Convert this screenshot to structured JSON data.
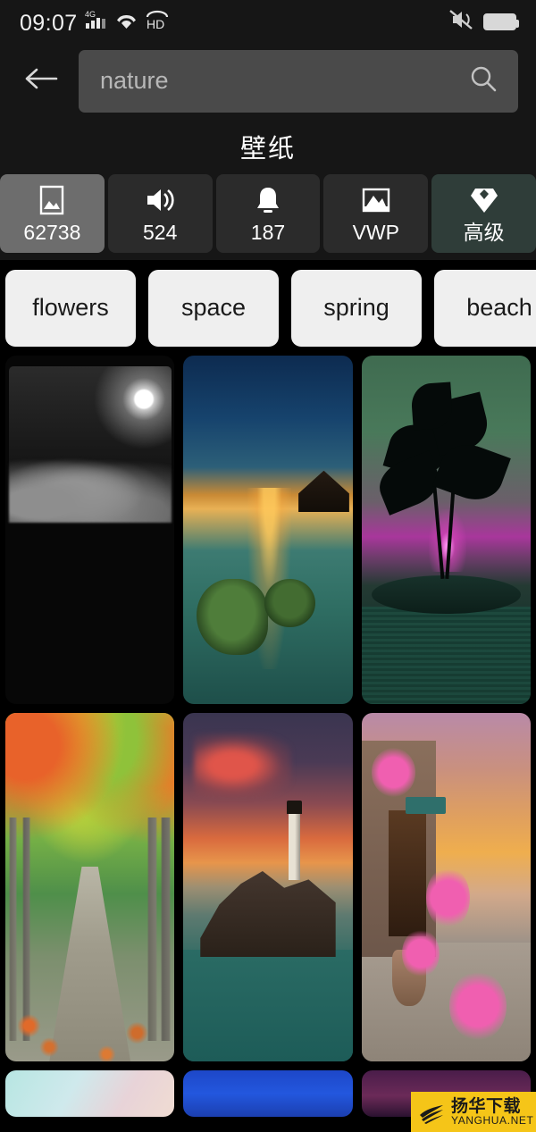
{
  "status_bar": {
    "time": "09:07",
    "network_label": "4G",
    "icons": [
      "signal-icon",
      "wifi-icon",
      "hd-icon",
      "vibrate-mute-icon",
      "battery-icon"
    ]
  },
  "search": {
    "back_icon": "back-arrow-icon",
    "value": "nature",
    "placeholder": "nature",
    "search_icon": "search-icon"
  },
  "header": {
    "title": "壁纸"
  },
  "tabs": [
    {
      "icon": "image-icon",
      "label": "62738",
      "selected": true,
      "style": "default"
    },
    {
      "icon": "speaker-icon",
      "label": "524",
      "selected": false,
      "style": "default"
    },
    {
      "icon": "bell-icon",
      "label": "187",
      "selected": false,
      "style": "default"
    },
    {
      "icon": "live-wallpaper-icon",
      "label": "VWP",
      "selected": false,
      "style": "default"
    },
    {
      "icon": "diamond-icon",
      "label": "高级",
      "selected": false,
      "style": "premium"
    }
  ],
  "chips": [
    {
      "label": "flowers"
    },
    {
      "label": "space"
    },
    {
      "label": "spring"
    },
    {
      "label": "beach"
    }
  ],
  "grid": {
    "rows": [
      [
        {
          "name": "moonlit-clouds-wallpaper"
        },
        {
          "name": "tropical-sunset-water-wallpaper"
        },
        {
          "name": "palm-trees-magenta-sky-wallpaper"
        }
      ],
      [
        {
          "name": "autumn-tree-path-wallpaper"
        },
        {
          "name": "lighthouse-sunset-wallpaper"
        },
        {
          "name": "flower-alley-sunset-wallpaper"
        }
      ],
      [
        {
          "name": "pastel-gradient-wallpaper"
        },
        {
          "name": "blue-sky-wallpaper"
        },
        {
          "name": "purple-dusk-wallpaper"
        }
      ]
    ]
  },
  "watermark": {
    "cn": "扬华下载",
    "en": "YANGHUA.NET",
    "bg_color": "#f5c518"
  },
  "colors": {
    "page_bg": "#000000",
    "chrome_bg": "#161616",
    "search_field": "#4a4a4a",
    "tab_bg": "#2b2b2b",
    "tab_selected_bg": "#6d6d6d",
    "tab_premium_bg": "#2f3d39",
    "chip_bg": "#efefef",
    "text_primary": "#ffffff"
  }
}
